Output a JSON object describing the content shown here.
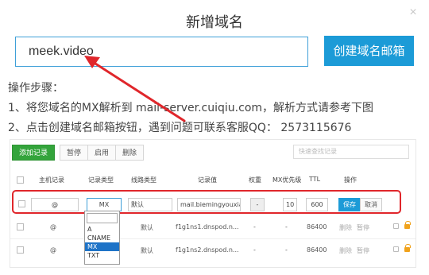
{
  "dialog": {
    "title": "新增域名",
    "close_glyph": "×"
  },
  "domain_input": {
    "value": "meek.video",
    "placeholder": ""
  },
  "create_button": {
    "label": "创建域名邮箱"
  },
  "steps": {
    "heading": "操作步骤：",
    "step1": "1、将您域名的MX解析到 mail-server.cuiqiu.com，解析方式请参考下图",
    "step2": "2、点击创建域名邮箱按钮，遇到问题可联系客服QQ： 2573115676"
  },
  "toolbar": {
    "add_record": "添加记录",
    "pause": "暂停",
    "enable": "启用",
    "delete": "删除",
    "search_placeholder": "快速查找记录"
  },
  "table": {
    "headers": {
      "host": "主机记录",
      "type": "记录类型",
      "line": "线路类型",
      "value": "记录值",
      "weight": "权重",
      "mx_priority": "MX优先级",
      "ttl": "TTL",
      "actions": "操作"
    },
    "edit_row": {
      "host": "@",
      "type": "MX",
      "line": "默认",
      "value": "mail.biemingyouxian",
      "weight": "-",
      "mx_priority": "10",
      "ttl": "600",
      "save": "保存",
      "cancel": "取消"
    },
    "rows": [
      {
        "host": "@",
        "line": "默认",
        "value": "f1g1ns1.dnspod.n...",
        "weight": "-",
        "mx": "-",
        "ttl": "86400",
        "delete": "删除",
        "pause": "暂停"
      },
      {
        "host": "@",
        "line": "默认",
        "value": "f1g1ns2.dnspod.n...",
        "weight": "-",
        "mx": "-",
        "ttl": "86400",
        "delete": "删除",
        "pause": "暂停"
      }
    ]
  },
  "type_dropdown": {
    "options": [
      "A",
      "CNAME",
      "MX",
      "TXT"
    ],
    "selected": "MX"
  },
  "colors": {
    "primary": "#1c9bd7",
    "highlight": "#e0262b",
    "add_button": "#33a43b"
  }
}
